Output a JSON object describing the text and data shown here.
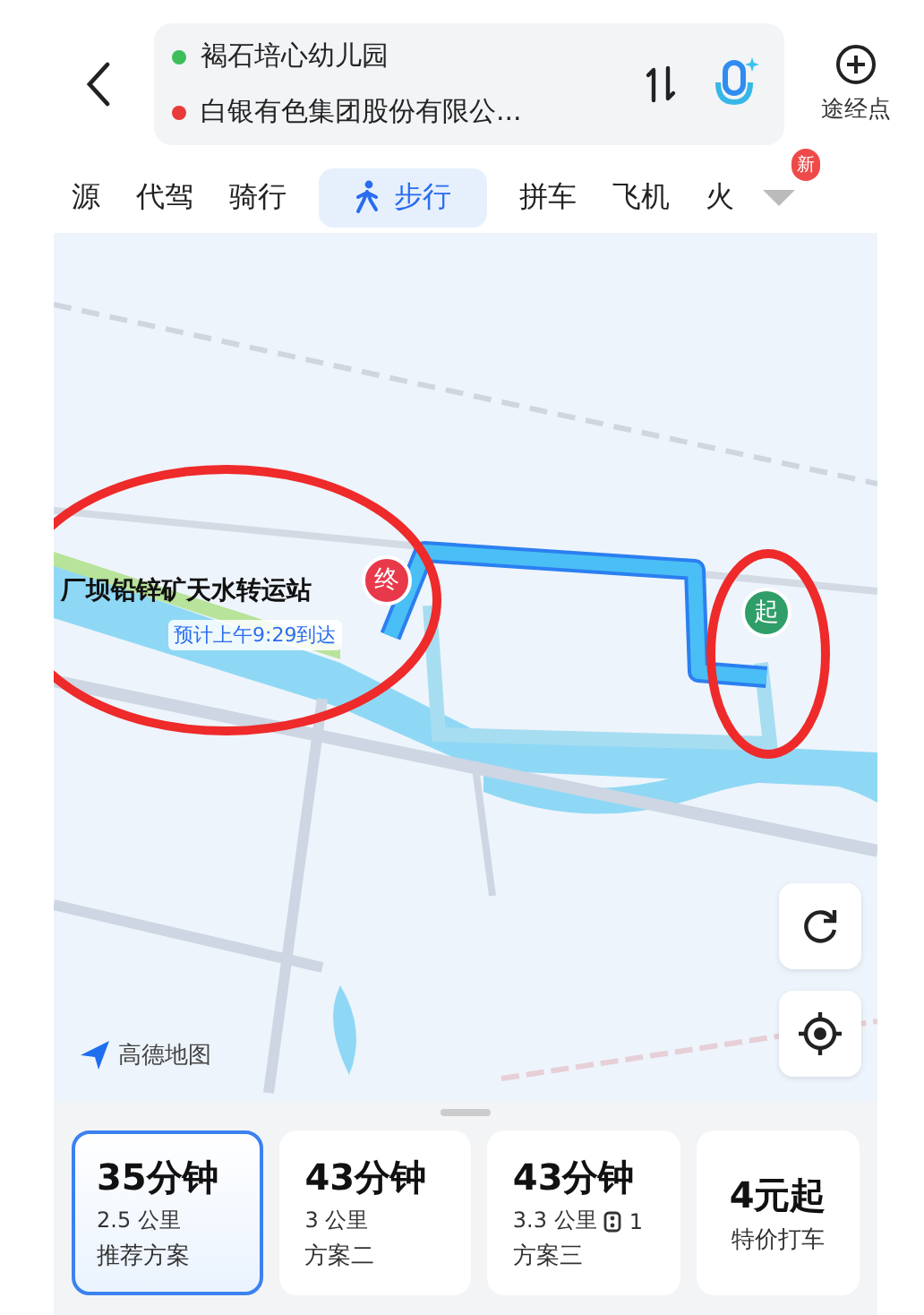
{
  "route": {
    "origin": "褐石培心幼儿园",
    "destination": "白银有色集团股份有限公...",
    "waypoint_label": "途经点"
  },
  "tabs": [
    {
      "label": "源",
      "selected": false
    },
    {
      "label": "代驾",
      "selected": false
    },
    {
      "label": "骑行",
      "selected": false
    },
    {
      "label": "步行",
      "selected": true
    },
    {
      "label": "拼车",
      "selected": false
    },
    {
      "label": "飞机",
      "selected": false
    },
    {
      "label": "火",
      "selected": false
    }
  ],
  "more_badge": "新",
  "map": {
    "destination_name": "厂坝铅锌矿天水转运站",
    "eta": "预计上午9:29到达",
    "end_marker": "终",
    "start_marker": "起",
    "map_logo": "高德地图"
  },
  "plans": [
    {
      "time": "35分钟",
      "distance": "2.5 公里",
      "name": "推荐方案",
      "selected": true
    },
    {
      "time": "43分钟",
      "distance": "3 公里",
      "name": "方案二",
      "selected": false
    },
    {
      "time": "43分钟",
      "distance": "3.3 公里",
      "lights": "1",
      "name": "方案三",
      "selected": false
    },
    {
      "time": "4元起",
      "name": "特价打车",
      "selected": false
    }
  ]
}
